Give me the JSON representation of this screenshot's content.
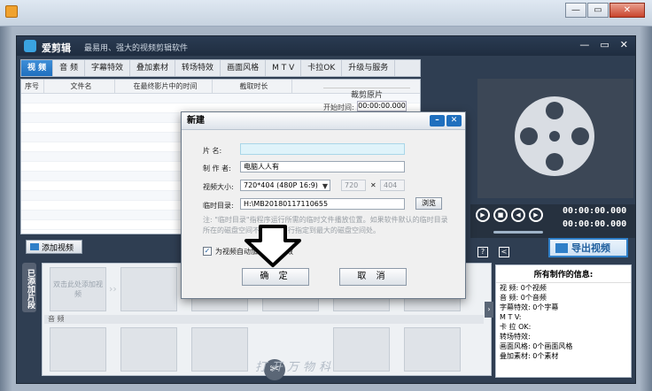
{
  "app": {
    "name": "爱剪辑",
    "slogan": "最易用、强大的视频剪辑软件",
    "window_controls": [
      "—",
      "▭",
      "✕"
    ]
  },
  "tabs": [
    "视 频",
    "音 频",
    "字幕特效",
    "叠加素材",
    "转场特效",
    "画面风格",
    "M T V",
    "卡拉OK",
    "升级与服务"
  ],
  "table_headers": [
    "序号",
    "文件名",
    "在最终影片中的时间",
    "截取时长"
  ],
  "crop": {
    "title": "裁剪原片",
    "start_label": "开始时间:",
    "start_value": "00:00:00.000"
  },
  "player": {
    "time_current": "00:00:00.000",
    "time_total": "00:00:00.000",
    "volume": 0.85
  },
  "buttons": {
    "add_video": "添加视频",
    "export": "导出视频"
  },
  "clips": {
    "sidebar_label": "已添加片段",
    "placeholder": "双击此处添加视频",
    "audio_label": "音 频"
  },
  "info_panel": {
    "title": "所有制作的信息:",
    "rows": [
      "视 频: 0个视频",
      "音 频: 0个音频",
      "字幕特效: 0个字幕",
      "M T V:",
      "卡 拉 OK:",
      "转场特效:",
      "画面风格: 0个画面风格",
      "叠加素材: 0个素材"
    ]
  },
  "dialog": {
    "title": "新建",
    "name_label": "片 名:",
    "name_value": "",
    "author_label": "制 作 者:",
    "author_value": "电脑人人有",
    "size_label": "视频大小:",
    "size_value": "720*404 (480P 16:9)",
    "width_value": "720",
    "height_value": "404",
    "times_sign": "✕",
    "temp_label": "临时目录:",
    "temp_value": "H:\\MB20180117110655",
    "browse_label": "浏览",
    "hint": "注: \"临时目录\"指程序运行所需的临时文件播放位置。如果软件默认的临时目录所在的磁盘空间不足，请自行指定到最大的磁盘空间处。",
    "checkbox_label": "为视频自动加入转场特效",
    "checkbox_checked": true,
    "ok_label": "确 定",
    "cancel_label": "取 消"
  },
  "watermark": "打开万物科"
}
